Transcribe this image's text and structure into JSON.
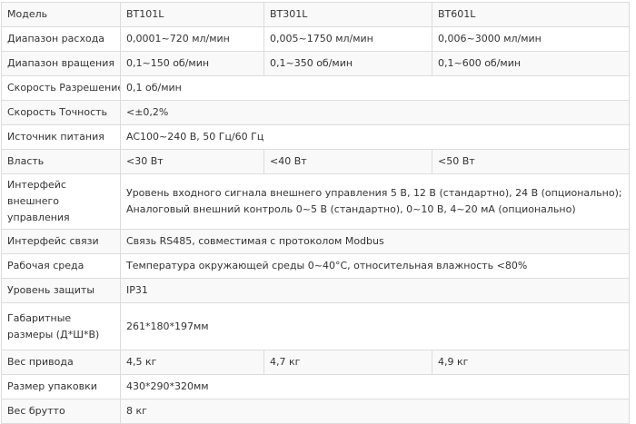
{
  "table": {
    "rows": [
      {
        "label": "Модель",
        "c1": "BT101L",
        "c2": "BT301L",
        "c3": "BT601L"
      },
      {
        "label": "Диапазон расхода",
        "c1": "0,0001~720 мл/мин",
        "c2": "0,005~1750 мл/мин",
        "c3": "0,006~3000 мл/мин"
      },
      {
        "label": "Диапазон вращения",
        "c1": "0,1~150 об/мин",
        "c2": "0,1~350 об/мин",
        "c3": "0,1~600 об/мин"
      },
      {
        "label": "Скорость Разрешение",
        "value": "0,1 об/мин"
      },
      {
        "label": "Скорость Точность",
        "value": "<±0,2%"
      },
      {
        "label": "Источник питания",
        "value": "AC100~240 В, 50 Гц/60 Гц"
      },
      {
        "label": "Власть",
        "c1": "<30 Вт",
        "c2": "<40 Вт",
        "c3": "<50 Вт"
      },
      {
        "label": "Интерфейс внешнего управления",
        "value_line1": "Уровень входного сигнала внешнего управления 5 В, 12 В (стандартно), 24 В (опционально);",
        "value_line2": "Аналоговый внешний контроль 0~5 В (стандартно), 0~10 В, 4~20 мА (опционально)"
      },
      {
        "label": "Интерфейс связи",
        "value": "Связь RS485, совместимая с протоколом Modbus"
      },
      {
        "label": "Рабочая среда",
        "value": "Температура окружающей среды 0~40°С, относительная влажность <80%"
      },
      {
        "label": "Уровень защиты",
        "value": "IP31"
      },
      {
        "label": "Габаритные размеры (Д*Ш*В)",
        "value": "261*180*197мм"
      },
      {
        "label": "Вес привода",
        "c1": "4,5 кг",
        "c2": "4,7 кг",
        "c3": "4,9 кг"
      },
      {
        "label": "Размер упаковки",
        "value": "430*290*320мм"
      },
      {
        "label": "Вес брутто",
        "value": "8 кг"
      }
    ]
  }
}
